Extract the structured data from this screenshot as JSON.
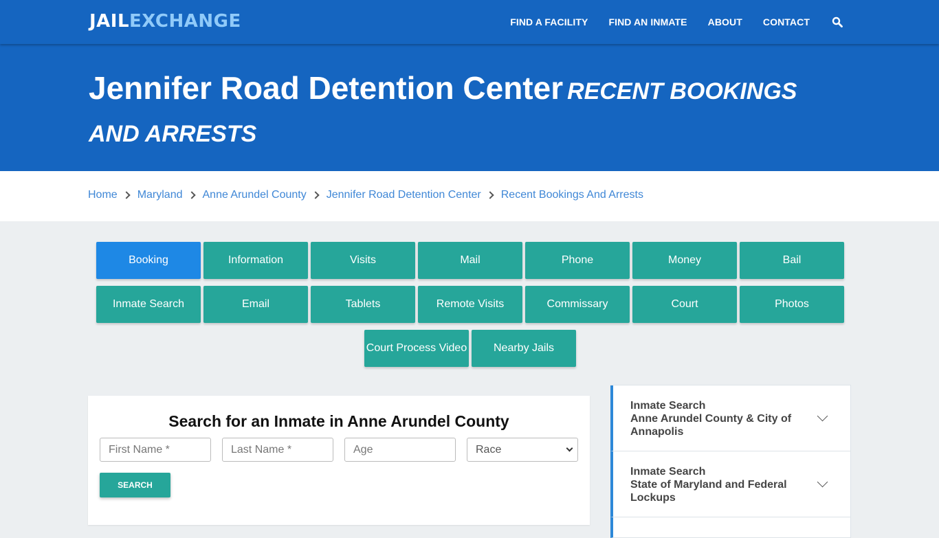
{
  "navbar": {
    "logo_part1": "JAIL",
    "logo_part2": "EXCHANGE",
    "links": [
      "FIND A FACILITY",
      "FIND AN INMATE",
      "ABOUT",
      "CONTACT"
    ],
    "search_icon": "search-icon"
  },
  "hero": {
    "title": "Jennifer Road Detention Center",
    "subtitle": "Recent Bookings And Arrests"
  },
  "breadcrumb": [
    "Home",
    "Maryland",
    "Anne Arundel County",
    "Jennifer Road Detention Center",
    "Recent Bookings And Arrests"
  ],
  "tiles": [
    {
      "label": "Booking",
      "active": true
    },
    {
      "label": "Information"
    },
    {
      "label": "Visits"
    },
    {
      "label": "Mail"
    },
    {
      "label": "Phone"
    },
    {
      "label": "Money"
    },
    {
      "label": "Bail"
    },
    {
      "label": "Inmate Search"
    },
    {
      "label": "Email"
    },
    {
      "label": "Tablets"
    },
    {
      "label": "Remote Visits"
    },
    {
      "label": "Commissary"
    },
    {
      "label": "Court"
    },
    {
      "label": "Photos"
    },
    {
      "label": "Court Process Video"
    },
    {
      "label": "Nearby Jails"
    }
  ],
  "search": {
    "title": "Search for an Inmate in Anne Arundel County",
    "first_name_placeholder": "First Name *",
    "last_name_placeholder": "Last Name *",
    "age_placeholder": "Age",
    "race_selected": "Race",
    "button_label": "SEARCH"
  },
  "sidebar": {
    "items": [
      {
        "line1": "Inmate Search",
        "line2": "Anne Arundel County & City of Annapolis"
      },
      {
        "line1": "Inmate Search",
        "line2": "State of Maryland and Federal Lockups"
      }
    ]
  },
  "colors": {
    "brand_blue": "#1565c0",
    "logo_accent": "#90caf9",
    "tile_teal": "#26a69a",
    "tile_active": "#1e88e5",
    "link_blue": "#3f87d6"
  }
}
